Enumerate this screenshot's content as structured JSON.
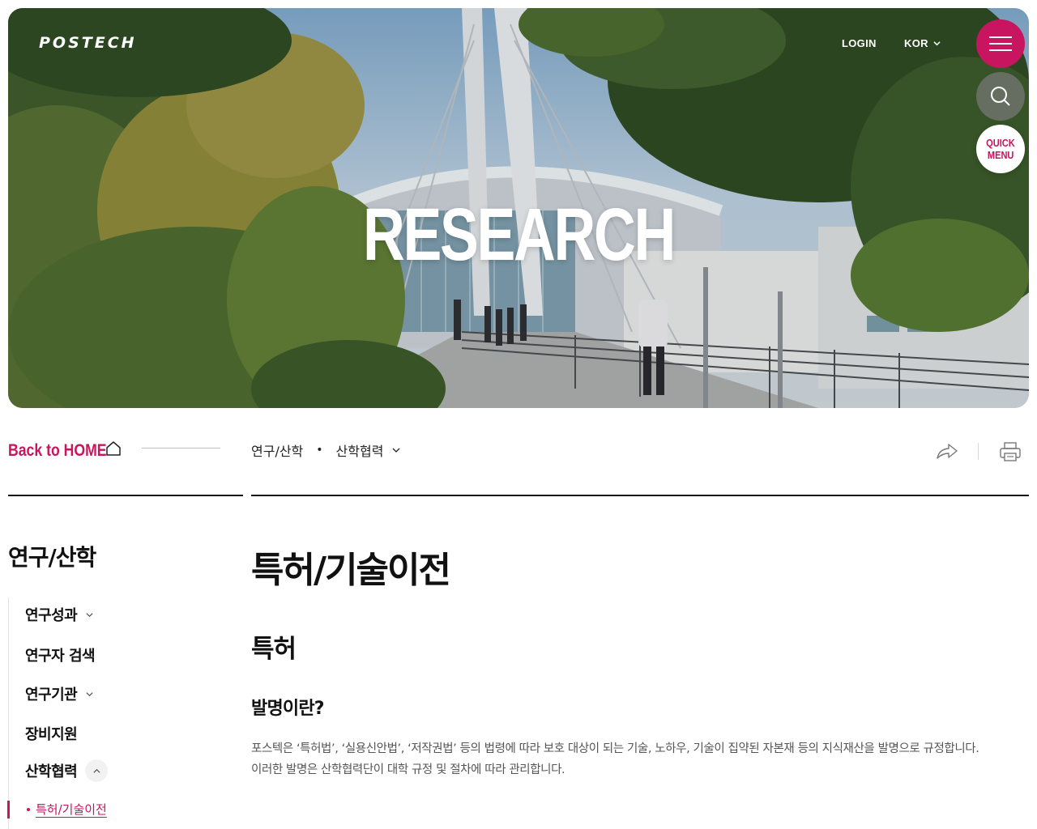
{
  "header": {
    "logo": "POSTECH",
    "login": "LOGIN",
    "language": "KOR",
    "quick_menu": [
      "QUICK",
      "MENU"
    ]
  },
  "hero": {
    "title": "RESEARCH"
  },
  "breadcrumb": {
    "back_home": "Back to HOME",
    "level1": "연구/산학",
    "separator": "•",
    "level2": "산학협력"
  },
  "sidebar": {
    "title": "연구/산학",
    "items": [
      {
        "label": "연구성과"
      },
      {
        "label": "연구자 검색"
      },
      {
        "label": "연구기관"
      },
      {
        "label": "장비지원"
      },
      {
        "label": "산학협력"
      }
    ],
    "active_sub": "특허/기술이전"
  },
  "main": {
    "page_title": "특허/기술이전",
    "section_title": "특허",
    "subsection_title": "발명이란?",
    "paragraph_line1": "포스텍은 ‘특허법’, ‘실용신안법’, ‘저작권법’ 등의 법령에 따라 보호 대상이 되는 기술, 노하우, 기술이 집약된 자본재 등의 지식재산을 발명으로 규정합니다.",
    "paragraph_line2": "이러한 발명은 산학협력단이 대학 규정 및 절차에 따라 관리합니다."
  },
  "colors": {
    "accent": "#c7165f",
    "text": "#111111",
    "muted": "#555555"
  },
  "icons": [
    "home-icon",
    "chevron-down-icon",
    "share-icon",
    "print-icon",
    "hamburger-icon",
    "search-icon",
    "chevron-up-icon"
  ]
}
